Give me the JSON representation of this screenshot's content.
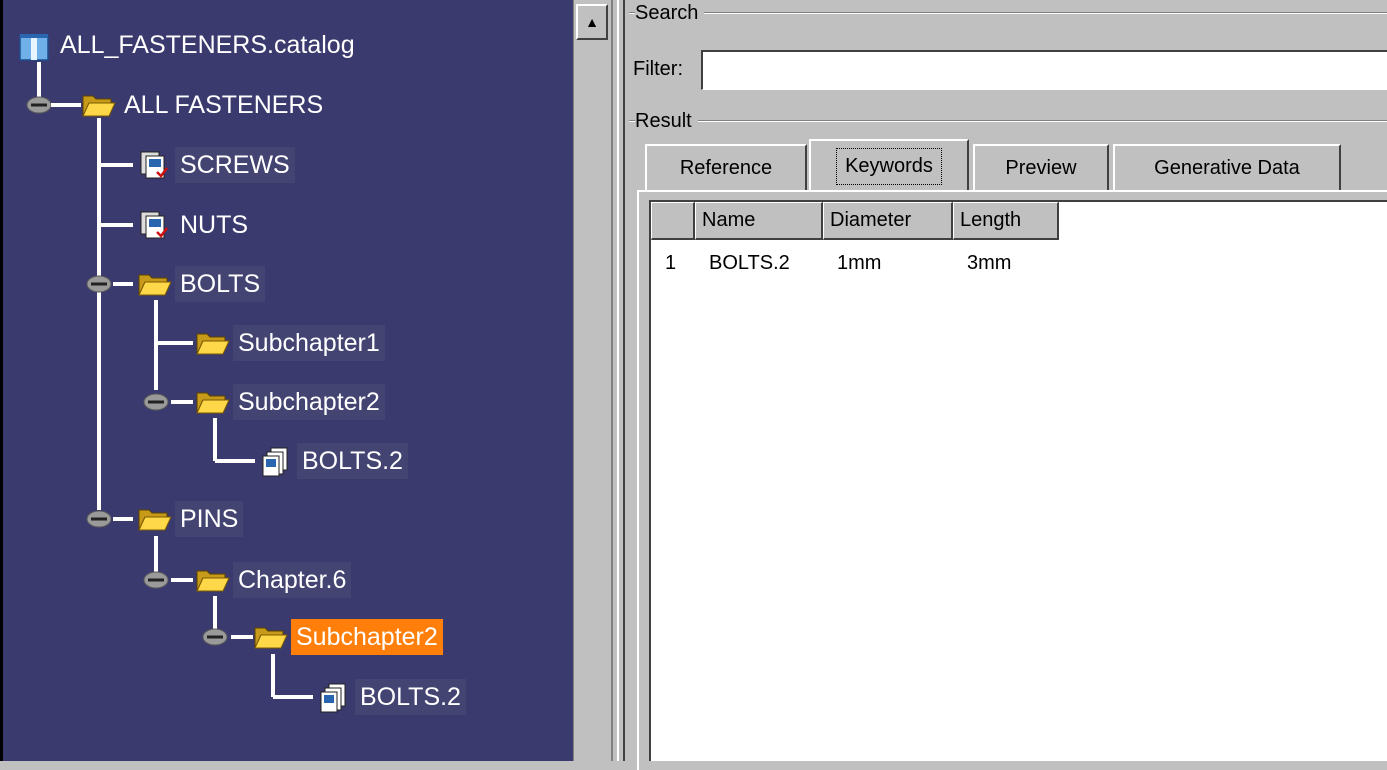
{
  "tree": {
    "root": {
      "label": "ALL_FASTENERS.catalog",
      "icon": "catalog-book-icon"
    },
    "nodes": [
      {
        "label": "ALL FASTENERS",
        "icon": "open-folder-icon"
      },
      {
        "label": "SCREWS",
        "icon": "part-family-icon"
      },
      {
        "label": "NUTS",
        "icon": "part-family-icon"
      },
      {
        "label": "BOLTS",
        "icon": "open-folder-icon"
      },
      {
        "label": "Subchapter1",
        "icon": "open-folder-icon"
      },
      {
        "label": "Subchapter2",
        "icon": "open-folder-icon"
      },
      {
        "label": "BOLTS.2",
        "icon": "document-stack-icon"
      },
      {
        "label": "PINS",
        "icon": "open-folder-icon"
      },
      {
        "label": "Chapter.6",
        "icon": "open-folder-icon"
      },
      {
        "label": "Subchapter2",
        "icon": "open-folder-icon",
        "selected": true
      },
      {
        "label": "BOLTS.2",
        "icon": "document-stack-icon"
      }
    ]
  },
  "search": {
    "group_label": "Search",
    "filter_label": "Filter:",
    "filter_value": ""
  },
  "result": {
    "group_label": "Result",
    "tabs": [
      {
        "label": "Reference"
      },
      {
        "label": "Keywords",
        "active": true
      },
      {
        "label": "Preview"
      },
      {
        "label": "Generative Data"
      }
    ],
    "columns": [
      "",
      "Name",
      "Diameter",
      "Length"
    ],
    "rows": [
      {
        "index": "1",
        "name": "BOLTS.2",
        "diameter": "1mm",
        "length": "3mm"
      }
    ]
  },
  "colors": {
    "tree_background": "#3b3a6e",
    "selection": "#ff7f0a",
    "window_gray": "#c0c0c0"
  }
}
